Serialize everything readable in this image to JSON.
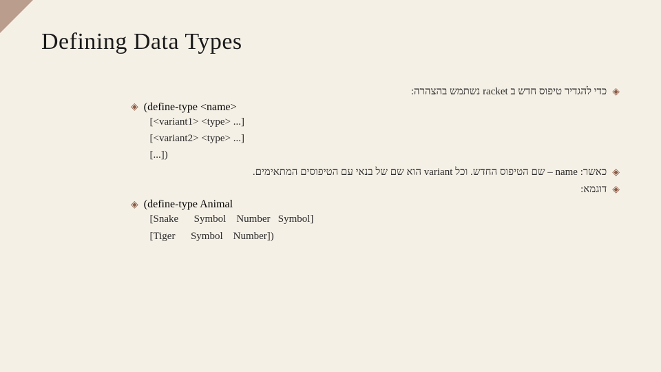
{
  "title": "Defining Data Types",
  "bullets": {
    "b1": "כדי להגדיר טיפוס חדש ב racket נשתמש בהצהרה:",
    "b2": "(define-type <name>",
    "code1_l2": "  [<variant1> <type> ...]",
    "code1_l3": "  [<variant2> <type> ...]",
    "code1_l4": "  [...])",
    "b3": "כאשר: name – שם הטיפוס החדש. וכל variant הוא שם של בנאי עם הטיפוסים המתאימים.",
    "b4": "דוגמא:",
    "b5": "(define-type Animal",
    "code2_l2": "  [Snake      Symbol    Number   Symbol]",
    "code2_l3": "  [Tiger      Symbol    Number])"
  },
  "icons": {
    "diamond": "◈"
  }
}
